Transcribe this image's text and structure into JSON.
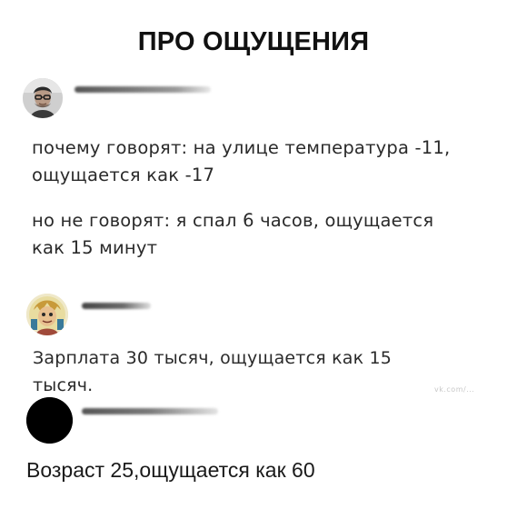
{
  "title": "ПРО ОЩУЩЕНИЯ",
  "posts": [
    {
      "avatar_icon": "person-photo-icon",
      "lines": [
        "почему говорят: на улице температура -11,",
        "ощущается как -17"
      ]
    },
    {
      "lines": [
        "но не говорят: я спал 6 часов, ощущается",
        "как 15 минут"
      ]
    },
    {
      "avatar_icon": "character-avatar-icon",
      "lines": [
        "Зарплата 30 тысяч, ощущается как 15",
        "тысяч."
      ]
    },
    {
      "avatar_icon": "black-circle-avatar-icon",
      "lines": [
        "Возраст 25,ощущается как 60"
      ]
    }
  ],
  "watermark": "vk.com/..."
}
